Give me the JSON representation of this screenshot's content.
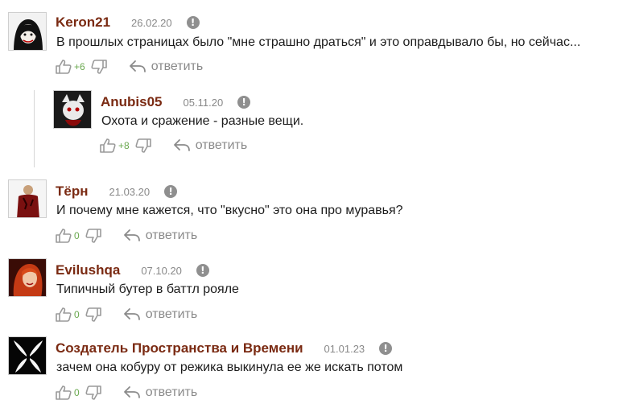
{
  "reply_label": "ответить",
  "comments": [
    {
      "author": "Keron21",
      "date": "26.02.20",
      "text": "В прошлых страницах было \"мне страшно драться\" и это оправдывало бы, но сейчас...",
      "likes": "+6"
    },
    {
      "author": "Anubis05",
      "date": "05.11.20",
      "text": "Охота и сражение - разные вещи.",
      "likes": "+8"
    },
    {
      "author": "Тёрн",
      "date": "21.03.20",
      "text": "И почему мне кажется, что \"вкусно\" это она про муравья?",
      "likes": "0"
    },
    {
      "author": "Evilushqa",
      "date": "07.10.20",
      "text": "Типичный бутер в баттл рояле",
      "likes": "0"
    },
    {
      "author": "Создатель Пространства и Времени",
      "date": "01.01.23",
      "text": "зачем она кобуру от режика выкинула ее же искать потом",
      "likes": "0"
    }
  ],
  "colors": {
    "author": "#7a2a12",
    "likes": "#6aa84f",
    "muted": "#8a8a8a"
  }
}
